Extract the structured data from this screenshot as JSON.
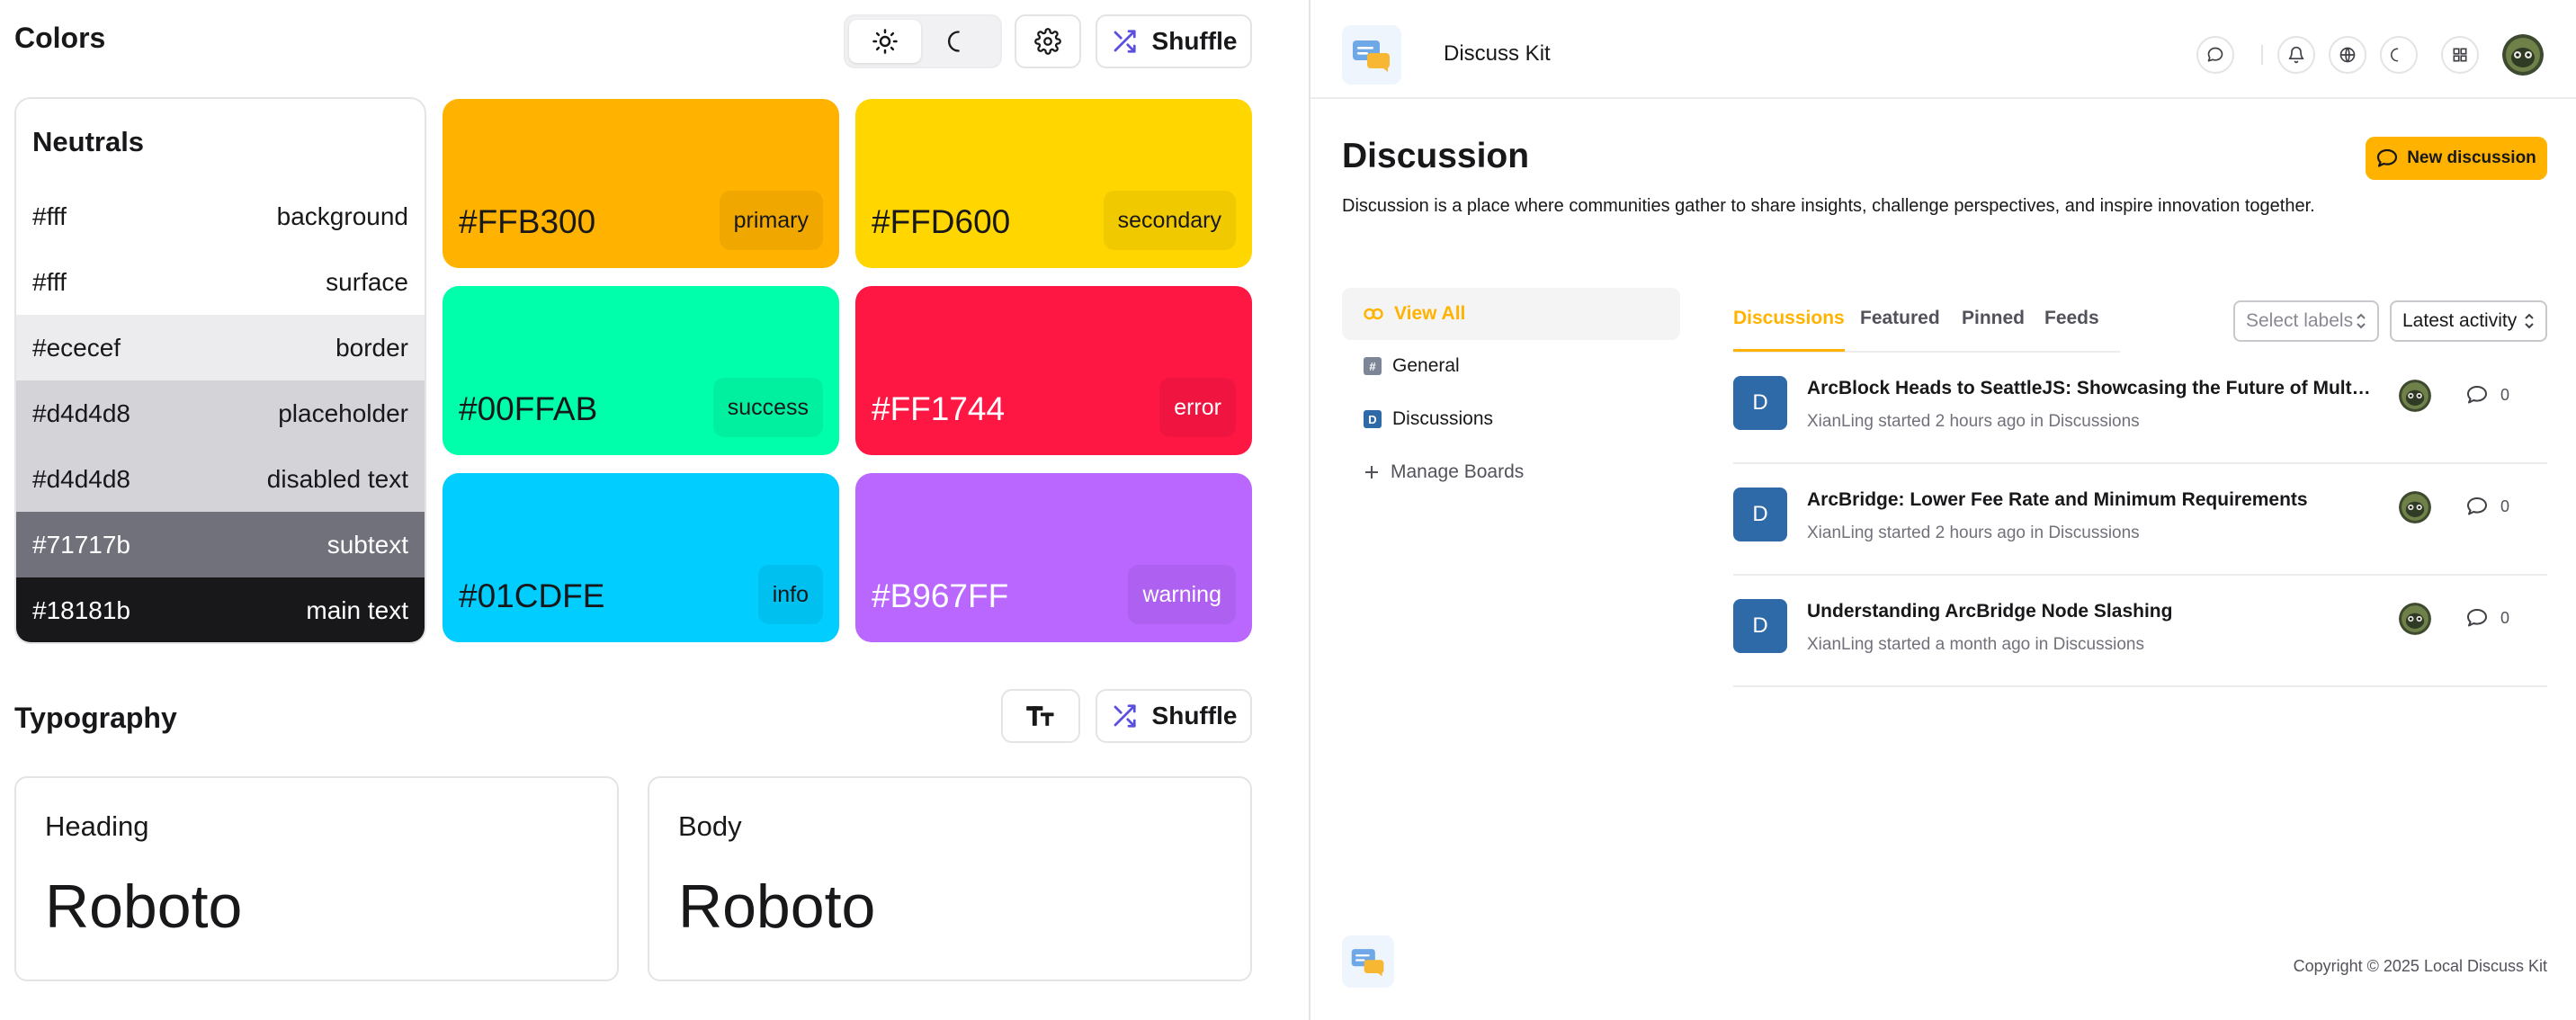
{
  "colors": {
    "title": "Colors",
    "shuffle_label": "Shuffle",
    "neutrals": {
      "title": "Neutrals",
      "rows": [
        {
          "hex": "#fff",
          "name": "background",
          "bg": "#ffffff",
          "fg": "#18181b"
        },
        {
          "hex": "#fff",
          "name": "surface",
          "bg": "#ffffff",
          "fg": "#18181b"
        },
        {
          "hex": "#ececef",
          "name": "border",
          "bg": "#ececef",
          "fg": "#18181b"
        },
        {
          "hex": "#d4d4d8",
          "name": "placeholder",
          "bg": "#d4d4d8",
          "fg": "#18181b"
        },
        {
          "hex": "#d4d4d8",
          "name": "disabled text",
          "bg": "#d4d4d8",
          "fg": "#18181b"
        },
        {
          "hex": "#71717b",
          "name": "subtext",
          "bg": "#71717b",
          "fg": "#ffffff"
        },
        {
          "hex": "#18181b",
          "name": "main text",
          "bg": "#18181b",
          "fg": "#ffffff"
        }
      ]
    },
    "swatches": [
      {
        "hex": "#FFB300",
        "name": "primary",
        "bg": "#ffb300",
        "fg": "#18181b"
      },
      {
        "hex": "#FFD600",
        "name": "secondary",
        "bg": "#ffd600",
        "fg": "#18181b"
      },
      {
        "hex": "#00FFAB",
        "name": "success",
        "bg": "#00ffab",
        "fg": "#18181b"
      },
      {
        "hex": "#FF1744",
        "name": "error",
        "bg": "#ff1744",
        "fg": "#ffffff"
      },
      {
        "hex": "#01CDFE",
        "name": "info",
        "bg": "#01cdfe",
        "fg": "#18181b"
      },
      {
        "hex": "#B967FF",
        "name": "warning",
        "bg": "#b967ff",
        "fg": "#ffffff"
      }
    ]
  },
  "typography": {
    "title": "Typography",
    "shuffle_label": "Shuffle",
    "heading": {
      "label": "Heading",
      "font": "Roboto"
    },
    "body": {
      "label": "Body",
      "font": "Roboto"
    }
  },
  "preview": {
    "app_name": "Discuss Kit",
    "page_title": "Discussion",
    "page_desc": "Discussion is a place where communities gather to share insights, challenge perspectives, and inspire innovation together.",
    "new_discussion_label": "New discussion",
    "sidebar": [
      {
        "label": "View All"
      },
      {
        "label": "General"
      },
      {
        "label": "Discussions"
      },
      {
        "label": "Manage Boards"
      }
    ],
    "tabs": [
      {
        "label": "Discussions"
      },
      {
        "label": "Featured"
      },
      {
        "label": "Pinned"
      },
      {
        "label": "Feeds"
      }
    ],
    "select_labels_placeholder": "Select labels",
    "sort_label": "Latest activity",
    "discussions": [
      {
        "avatar_letter": "D",
        "title": "ArcBlock Heads to SeattleJS: Showcasing the Future of Multi-Agent Systems",
        "author": "XianLing",
        "time": "started 2 hours ago in",
        "board": "Discussions",
        "comments": "0"
      },
      {
        "avatar_letter": "D",
        "title": "ArcBridge: Lower Fee Rate and Minimum Requirements",
        "author": "XianLing",
        "time": "started 2 hours ago in",
        "board": "Discussions",
        "comments": "0"
      },
      {
        "avatar_letter": "D",
        "title": "Understanding ArcBridge Node Slashing",
        "author": "XianLing",
        "time": "started a month ago in",
        "board": "Discussions",
        "comments": "0"
      }
    ],
    "copyright": "Copyright © 2025 Local Discuss Kit",
    "accent_color": "#ffb300"
  }
}
